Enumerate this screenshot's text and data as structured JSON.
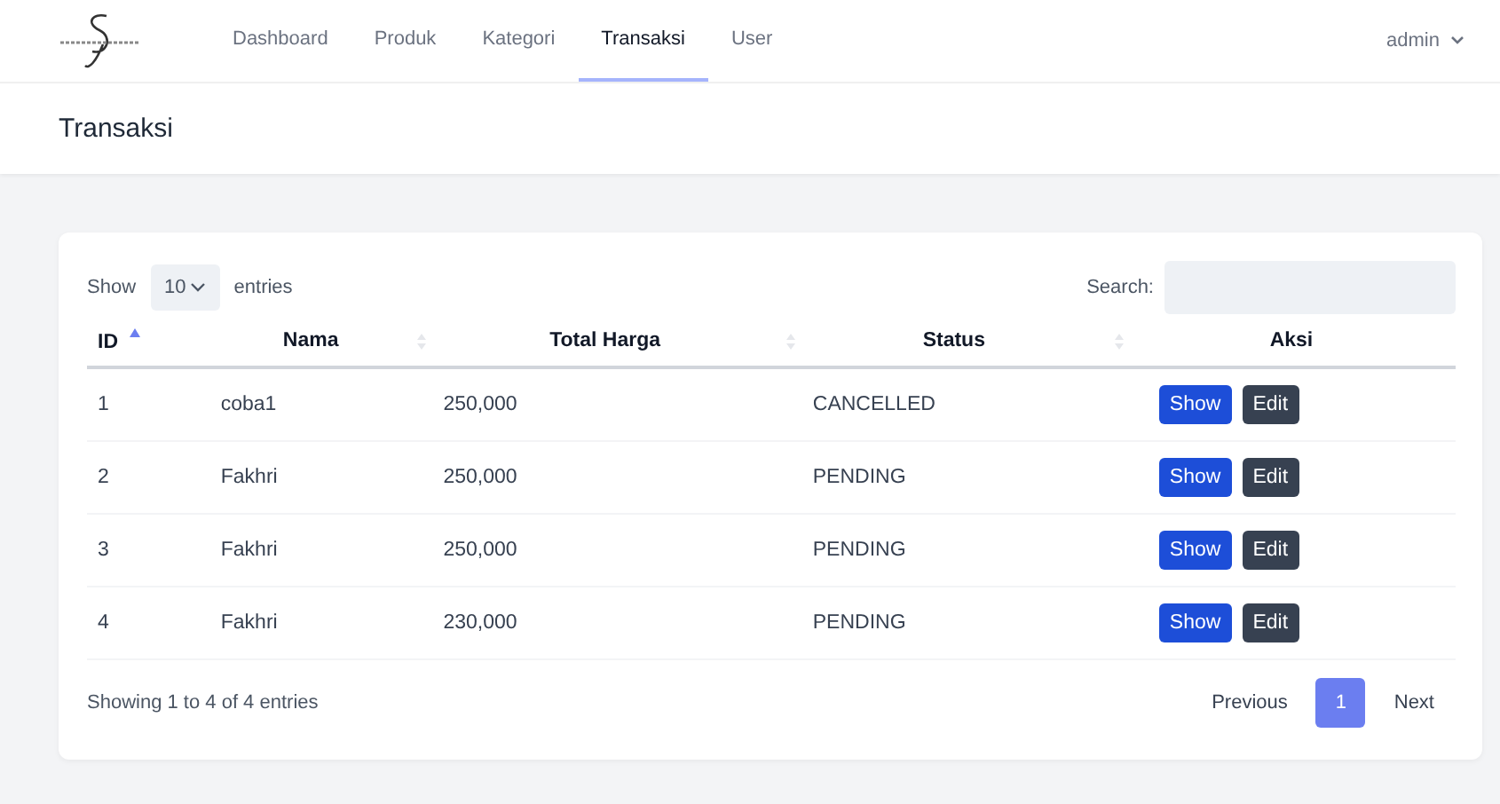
{
  "nav": {
    "items": [
      {
        "label": "Dashboard",
        "selected": false
      },
      {
        "label": "Produk",
        "selected": false
      },
      {
        "label": "Kategori",
        "selected": false
      },
      {
        "label": "Transaksi",
        "selected": true
      },
      {
        "label": "User",
        "selected": false
      }
    ],
    "user": "admin"
  },
  "page_title": "Transaksi",
  "table": {
    "length_before": "Show",
    "length_value": "10",
    "length_after": "entries",
    "search_label": "Search:",
    "columns": [
      {
        "label": "ID",
        "sortable": true,
        "sorted": true
      },
      {
        "label": "Nama",
        "sortable": true,
        "sorted": false
      },
      {
        "label": "Total Harga",
        "sortable": true,
        "sorted": false
      },
      {
        "label": "Status",
        "sortable": true,
        "sorted": false
      },
      {
        "label": "Aksi",
        "sortable": false,
        "sorted": false
      }
    ],
    "rows": [
      {
        "cells": [
          "1",
          "coba1",
          "250,000",
          "CANCELLED"
        ],
        "actions": [
          {
            "label": "Show",
            "kind": "primary"
          },
          {
            "label": "Edit",
            "kind": "dark"
          }
        ]
      },
      {
        "cells": [
          "2",
          "Fakhri",
          "250,000",
          "PENDING"
        ],
        "actions": [
          {
            "label": "Show",
            "kind": "primary"
          },
          {
            "label": "Edit",
            "kind": "dark"
          }
        ]
      },
      {
        "cells": [
          "3",
          "Fakhri",
          "250,000",
          "PENDING"
        ],
        "actions": [
          {
            "label": "Show",
            "kind": "primary"
          },
          {
            "label": "Edit",
            "kind": "dark"
          }
        ]
      },
      {
        "cells": [
          "4",
          "Fakhri",
          "230,000",
          "PENDING"
        ],
        "actions": [
          {
            "label": "Show",
            "kind": "primary"
          },
          {
            "label": "Edit",
            "kind": "dark"
          }
        ]
      }
    ],
    "info": "Showing 1 to 4 of 4 entries",
    "pagination": {
      "previous": "Previous",
      "pages": [
        {
          "label": "1",
          "selected": true
        }
      ],
      "next": "Next"
    }
  }
}
